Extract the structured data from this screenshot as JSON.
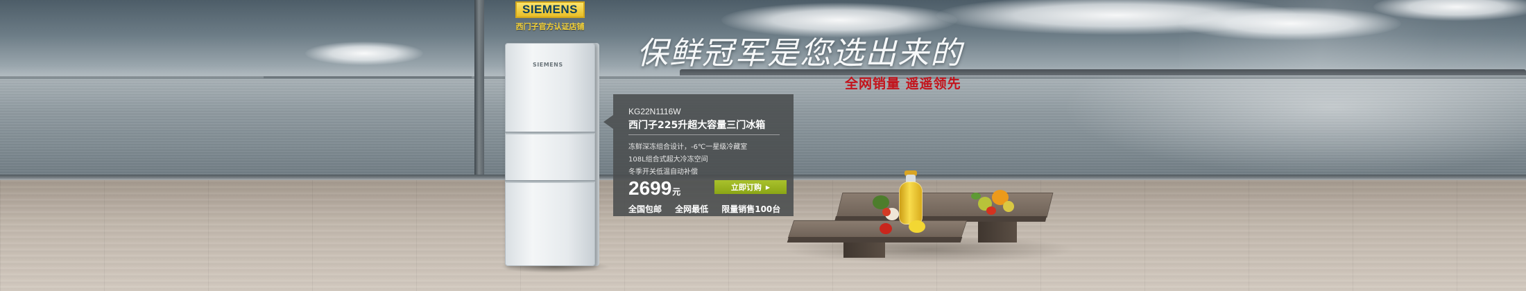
{
  "brand": {
    "logo_text": "SIEMENS",
    "subtitle": "西门子官方认证店铺"
  },
  "headline": {
    "title": "保鲜冠军是您选出来的",
    "subtitle": "全网销量  遥遥领先"
  },
  "product": {
    "model": "KG22N1116W",
    "name": "西门子225升超大容量三门冰箱",
    "features": [
      "冻鲜深冻组合设计，-6℃一星级冷藏室",
      "108L组合式超大冷冻空间",
      "冬季开关低温自动补偿"
    ],
    "price": "2699",
    "currency": "元",
    "buy_label": "立即订购",
    "perks": [
      "全国包邮",
      "全网最低",
      "限量销售100台"
    ]
  },
  "colors": {
    "headline_red": "#c3131b",
    "buy_green": "#8ba616",
    "brand_gold": "#e8bd27",
    "panel_gray": "#4a4d4f"
  },
  "icons": {
    "buy_arrow": "triangle-right-icon"
  }
}
